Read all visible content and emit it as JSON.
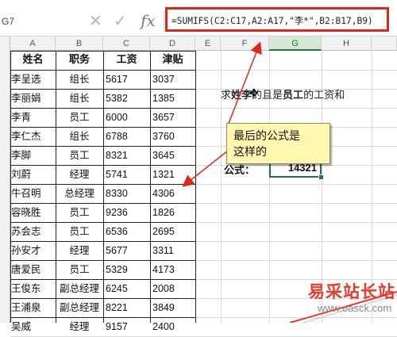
{
  "formula_bar": {
    "name_box": "G7",
    "cancel_icon": "✕",
    "enter_icon": "✓",
    "fx_label": "fx",
    "formula": "=SUMIFS(C2:C17,A2:A17,\"李*\",B2:B17,B9)"
  },
  "columns": [
    "A",
    "B",
    "C",
    "D",
    "E",
    "F",
    "G",
    "H"
  ],
  "selected_column": "G",
  "table": {
    "headers": [
      "姓名",
      "职务",
      "工资",
      "津贴"
    ],
    "rows": [
      [
        "李呈选",
        "组长",
        "5617",
        "3037"
      ],
      [
        "李丽娟",
        "组长",
        "5382",
        "1385"
      ],
      [
        "李青",
        "员工",
        "6000",
        "3657"
      ],
      [
        "李仁杰",
        "组长",
        "6788",
        "3760"
      ],
      [
        "李脚",
        "员工",
        "8321",
        "3645"
      ],
      [
        "刘蔚",
        "经理",
        "5741",
        "1321"
      ],
      [
        "牛召明",
        "总经理",
        "8330",
        "4306"
      ],
      [
        "容晓胜",
        "员工",
        "9236",
        "1826"
      ],
      [
        "苏会志",
        "员工",
        "6536",
        "2695"
      ],
      [
        "孙安才",
        "经理",
        "5677",
        "3311"
      ],
      [
        "唐爱民",
        "员工",
        "5329",
        "4173"
      ],
      [
        "王俊东",
        "副总经理",
        "6245",
        "2008"
      ],
      [
        "王浦泉",
        "副总经理",
        "8221",
        "3849"
      ],
      [
        "吴威",
        "经理",
        "9157",
        "2400"
      ]
    ]
  },
  "note": {
    "prefix": "求",
    "bold1": "姓李",
    "middle": "的且是",
    "bold2": "员工",
    "suffix": "的工资和"
  },
  "formula_label": "公式：",
  "result": "14321",
  "callout": {
    "line1": "最后的公式是",
    "line2": "这样的"
  },
  "watermark": {
    "text": "易采站长站",
    "url": "www.easck.com"
  },
  "colors": {
    "accent_red": "#e0251b",
    "excel_green": "#217346",
    "callout_fill": "#fff6b0"
  }
}
